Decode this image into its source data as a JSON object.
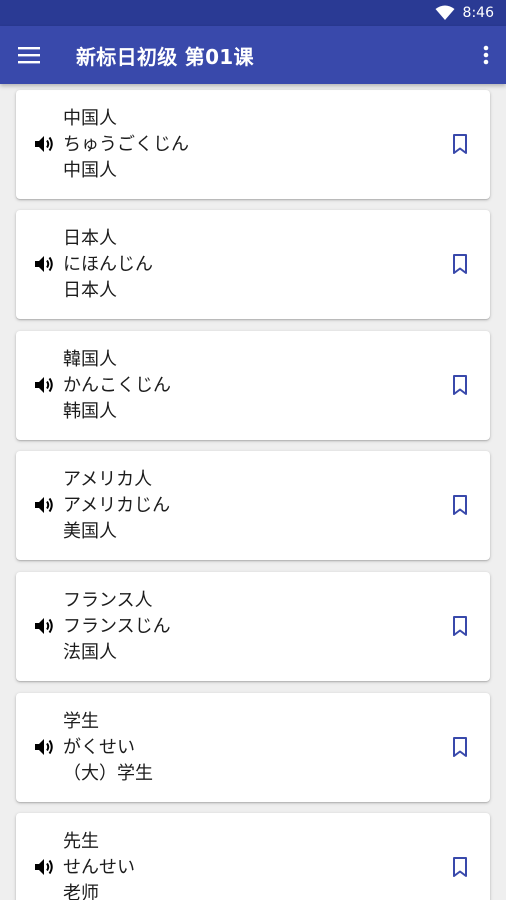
{
  "status": {
    "time": "8:46"
  },
  "toolbar": {
    "title": "新标日初级 第01课"
  },
  "colors": {
    "primary": "#3949ab",
    "status_bar": "#2a3a94",
    "accent": "#3949ab"
  },
  "icons": {
    "menu": "menu-icon",
    "more": "more-vert-icon",
    "speaker": "speaker-icon",
    "bookmark": "bookmark-outline-icon"
  },
  "words": [
    {
      "kanji": "中国人",
      "kana": "ちゅうごくじん",
      "meaning": "中国人"
    },
    {
      "kanji": "日本人",
      "kana": "にほんじん",
      "meaning": "日本人"
    },
    {
      "kanji": "韓国人",
      "kana": "かんこくじん",
      "meaning": "韩国人"
    },
    {
      "kanji": "アメリカ人",
      "kana": "アメリカじん",
      "meaning": "美国人"
    },
    {
      "kanji": "フランス人",
      "kana": "フランスじん",
      "meaning": "法国人"
    },
    {
      "kanji": "学生",
      "kana": "がくせい",
      "meaning": "（大）学生"
    },
    {
      "kanji": "先生",
      "kana": "せんせい",
      "meaning": "老师"
    }
  ]
}
